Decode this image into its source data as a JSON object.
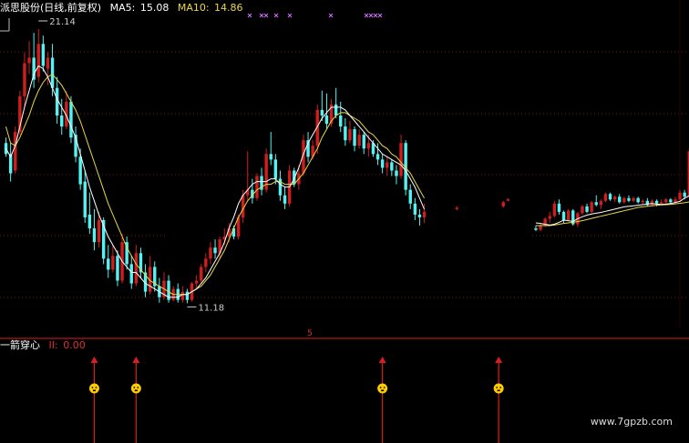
{
  "header": {
    "name": "派思股份(日线,前复权)",
    "ma5_label": "MA5:",
    "ma5_value": "15.08",
    "ma10_label": "MA10:",
    "ma10_value": "14.86"
  },
  "indicator": {
    "name": "一箭穿心",
    "value_label": "II:",
    "value": "0.00",
    "marker_label": "5"
  },
  "watermark": "www.7gpzb.com",
  "colors": {
    "up": "#d01e1e",
    "down": "#54f2f2",
    "ma5": "#ffffff",
    "ma10": "#e8d84a",
    "grid": "#7a1010",
    "axis": "#b01818",
    "signal": "#d81e1e",
    "face": "#ffcc00",
    "ticks": "#d070ff"
  },
  "chart_data": {
    "type": "candlestick",
    "y_range": [
      10.3,
      21.6
    ],
    "annotations": [
      {
        "label": "21.14",
        "candle": 7,
        "value": 21.14
      },
      {
        "label": "11.18",
        "candle": 39,
        "value": 11.18
      }
    ],
    "ma5": [
      16.8,
      16.5,
      16.9,
      17.6,
      18.3,
      18.9,
      19.5,
      19.8,
      19.7,
      19.4,
      19.0,
      18.6,
      18.3,
      18.0,
      17.6,
      17.2,
      16.6,
      16.0,
      15.4,
      14.9,
      14.4,
      14.0,
      13.6,
      13.3,
      13.0,
      12.7,
      12.5,
      12.3,
      12.3,
      12.1,
      11.9,
      11.8,
      11.7,
      11.6,
      11.5,
      11.4,
      11.4,
      11.4,
      11.5,
      11.5,
      11.6,
      11.7,
      11.9,
      12.1,
      12.4,
      12.7,
      13.0,
      13.4,
      13.9,
      14.3,
      14.8,
      15.1,
      15.3,
      15.5,
      15.6,
      15.6,
      15.6,
      15.7,
      15.7,
      15.5,
      15.4,
      15.4,
      15.7,
      16.1,
      16.6,
      17.0,
      17.3,
      17.6,
      17.9,
      18.1,
      18.3,
      18.3,
      18.3,
      18.2,
      18.0,
      17.8,
      17.6,
      17.4,
      17.2,
      17.0,
      16.8,
      16.6,
      16.5,
      16.4,
      16.3,
      16.2,
      16.0,
      15.7,
      15.4,
      15.0,
      14.6
    ],
    "ma10": [
      17.6,
      17.0,
      16.9,
      17.2,
      17.6,
      18.0,
      18.5,
      18.9,
      19.2,
      19.4,
      19.5,
      19.3,
      19.1,
      18.8,
      18.5,
      18.2,
      17.8,
      17.3,
      16.8,
      16.3,
      15.8,
      15.3,
      14.8,
      14.4,
      14.0,
      13.6,
      13.2,
      12.9,
      12.6,
      12.4,
      12.2,
      12.0,
      11.9,
      11.8,
      11.7,
      11.6,
      11.5,
      11.5,
      11.5,
      11.5,
      11.6,
      11.7,
      11.8,
      12.0,
      12.2,
      12.5,
      12.8,
      13.1,
      13.5,
      13.9,
      14.3,
      14.6,
      14.9,
      15.1,
      15.3,
      15.4,
      15.5,
      15.5,
      15.6,
      15.6,
      15.5,
      15.5,
      15.5,
      15.7,
      15.9,
      16.2,
      16.5,
      16.8,
      17.2,
      17.5,
      17.8,
      18.0,
      18.1,
      18.1,
      18.0,
      17.9,
      17.8,
      17.6,
      17.4,
      17.3,
      17.1,
      16.9,
      16.8,
      16.6,
      16.5,
      16.3,
      16.1,
      15.9,
      15.6,
      15.3,
      15.0
    ],
    "ma_late": {
      "start": 114,
      "ma5": [
        14.1,
        14.08,
        14.05,
        14.02,
        14.05,
        14.12,
        14.2,
        14.18,
        14.15,
        14.25,
        14.32,
        14.38,
        14.42,
        14.45,
        14.48,
        14.52,
        14.56,
        14.6,
        14.64,
        14.68,
        14.7,
        14.72,
        14.74,
        14.76,
        14.78,
        14.8,
        14.78,
        14.77,
        14.78,
        14.8,
        14.84,
        14.88,
        15.0,
        15.08
      ],
      "ma10": [
        14.0,
        14.0,
        14.0,
        14.0,
        14.02,
        14.05,
        14.08,
        14.1,
        14.12,
        14.15,
        14.18,
        14.22,
        14.26,
        14.3,
        14.34,
        14.38,
        14.42,
        14.46,
        14.5,
        14.54,
        14.58,
        14.62,
        14.66,
        14.68,
        14.7,
        14.72,
        14.74,
        14.75,
        14.76,
        14.77,
        14.79,
        14.81,
        14.83,
        14.86
      ]
    },
    "ohlc": [
      [
        17.0,
        17.2,
        16.5,
        16.6
      ],
      [
        16.6,
        17.0,
        15.6,
        15.9
      ],
      [
        16.0,
        17.6,
        15.9,
        17.4
      ],
      [
        17.4,
        18.9,
        17.3,
        18.7
      ],
      [
        18.7,
        20.3,
        18.3,
        19.9
      ],
      [
        19.9,
        20.7,
        19.5,
        20.1
      ],
      [
        20.1,
        21.0,
        19.0,
        19.3
      ],
      [
        19.4,
        21.14,
        19.2,
        20.6
      ],
      [
        20.6,
        20.9,
        19.6,
        19.8
      ],
      [
        19.7,
        20.3,
        19.1,
        20.1
      ],
      [
        20.1,
        20.6,
        18.7,
        19.0
      ],
      [
        19.0,
        19.4,
        17.7,
        18.0
      ],
      [
        18.0,
        18.6,
        17.3,
        17.6
      ],
      [
        17.6,
        18.9,
        17.5,
        18.5
      ],
      [
        18.5,
        18.7,
        17.0,
        17.2
      ],
      [
        17.3,
        17.6,
        16.3,
        16.5
      ],
      [
        16.5,
        16.8,
        15.3,
        15.5
      ],
      [
        15.6,
        16.0,
        14.1,
        14.3
      ],
      [
        14.4,
        15.2,
        13.7,
        13.9
      ],
      [
        13.9,
        14.6,
        13.1,
        13.4
      ],
      [
        13.4,
        14.5,
        13.2,
        14.2
      ],
      [
        14.2,
        14.3,
        12.6,
        12.8
      ],
      [
        12.8,
        13.3,
        12.1,
        12.4
      ],
      [
        12.4,
        13.3,
        12.3,
        12.9
      ],
      [
        12.9,
        13.1,
        11.8,
        12.0
      ],
      [
        12.0,
        13.7,
        11.9,
        13.4
      ],
      [
        13.4,
        13.6,
        12.4,
        12.6
      ],
      [
        12.6,
        12.9,
        11.7,
        11.9
      ],
      [
        11.9,
        13.3,
        11.8,
        13.0
      ],
      [
        13.0,
        13.2,
        12.1,
        12.3
      ],
      [
        12.3,
        12.6,
        11.4,
        11.6
      ],
      [
        11.6,
        12.9,
        11.5,
        12.5
      ],
      [
        12.5,
        12.7,
        11.6,
        11.8
      ],
      [
        11.8,
        12.1,
        11.2,
        11.4
      ],
      [
        11.4,
        12.3,
        11.3,
        12.0
      ],
      [
        12.0,
        12.2,
        11.2,
        11.3
      ],
      [
        11.3,
        11.8,
        11.25,
        11.7
      ],
      [
        11.7,
        11.9,
        11.2,
        11.3
      ],
      [
        11.3,
        11.8,
        11.2,
        11.6
      ],
      [
        11.6,
        11.7,
        11.18,
        11.3
      ],
      [
        11.3,
        11.95,
        11.25,
        11.9
      ],
      [
        11.9,
        12.2,
        11.7,
        12.0
      ],
      [
        12.0,
        12.6,
        11.9,
        12.5
      ],
      [
        12.5,
        13.0,
        12.3,
        12.8
      ],
      [
        12.8,
        13.4,
        12.6,
        13.2
      ],
      [
        13.2,
        13.5,
        12.8,
        13.0
      ],
      [
        13.0,
        13.6,
        12.8,
        13.5
      ],
      [
        13.5,
        13.9,
        13.3,
        13.6
      ],
      [
        13.6,
        14.1,
        13.4,
        13.9
      ],
      [
        13.9,
        14.0,
        13.5,
        13.6
      ],
      [
        13.6,
        14.4,
        13.5,
        14.3
      ],
      [
        14.3,
        15.3,
        14.1,
        15.1
      ],
      [
        15.1,
        16.7,
        14.9,
        15.3
      ],
      [
        15.3,
        15.7,
        14.8,
        15.0
      ],
      [
        15.0,
        15.9,
        14.9,
        15.8
      ],
      [
        15.8,
        16.1,
        15.1,
        15.3
      ],
      [
        15.3,
        16.8,
        15.2,
        16.6
      ],
      [
        16.6,
        17.4,
        16.2,
        16.4
      ],
      [
        16.4,
        16.6,
        15.5,
        15.7
      ],
      [
        15.7,
        16.0,
        14.9,
        15.1
      ],
      [
        15.1,
        15.4,
        14.6,
        14.8
      ],
      [
        14.8,
        16.2,
        14.7,
        16.0
      ],
      [
        16.0,
        16.1,
        15.4,
        15.5
      ],
      [
        15.5,
        16.2,
        15.3,
        15.9
      ],
      [
        15.9,
        17.3,
        15.8,
        17.1
      ],
      [
        17.1,
        17.4,
        16.3,
        16.5
      ],
      [
        16.5,
        17.1,
        16.4,
        16.9
      ],
      [
        16.9,
        18.4,
        16.6,
        18.2
      ],
      [
        18.2,
        18.9,
        17.8,
        18.0
      ],
      [
        18.0,
        18.8,
        17.5,
        17.7
      ],
      [
        17.7,
        18.6,
        17.6,
        18.4
      ],
      [
        18.4,
        19.0,
        17.9,
        18.0
      ],
      [
        18.0,
        18.5,
        17.4,
        17.6
      ],
      [
        17.6,
        17.9,
        16.9,
        17.1
      ],
      [
        17.1,
        17.8,
        17.0,
        17.5
      ],
      [
        17.5,
        17.6,
        16.7,
        16.9
      ],
      [
        16.9,
        17.5,
        16.8,
        17.3
      ],
      [
        17.3,
        17.4,
        16.6,
        16.8
      ],
      [
        16.8,
        17.3,
        16.5,
        17.0
      ],
      [
        17.0,
        17.1,
        16.5,
        16.6
      ],
      [
        16.6,
        17.0,
        16.2,
        16.4
      ],
      [
        16.4,
        16.6,
        15.9,
        16.1
      ],
      [
        16.1,
        16.5,
        15.8,
        16.3
      ],
      [
        16.3,
        16.4,
        15.8,
        16.0
      ],
      [
        16.0,
        16.2,
        15.5,
        15.8
      ],
      [
        15.8,
        17.3,
        15.7,
        17.0
      ],
      [
        17.0,
        17.1,
        15.1,
        15.3
      ],
      [
        15.3,
        15.5,
        14.6,
        14.8
      ],
      [
        14.8,
        15.0,
        14.2,
        14.4
      ],
      [
        14.4,
        14.6,
        14.0,
        14.3
      ],
      [
        14.3,
        14.8,
        14.1,
        14.5
      ]
    ],
    "ohlc_mid": [
      {
        "index": 97,
        "bar": [
          14.6,
          14.7,
          14.55,
          14.65
        ]
      },
      {
        "index": 107,
        "bar": [
          14.7,
          14.9,
          14.65,
          14.85
        ]
      },
      {
        "index": 108,
        "bar": [
          14.9,
          15.0,
          14.9,
          14.95
        ]
      }
    ],
    "ohlc_late": {
      "start": 114,
      "bars": [
        [
          13.9,
          14.0,
          13.8,
          13.85
        ],
        [
          13.85,
          14.05,
          13.8,
          14.0
        ],
        [
          14.0,
          14.3,
          13.95,
          14.25
        ],
        [
          14.25,
          14.5,
          14.1,
          14.35
        ],
        [
          14.35,
          14.9,
          14.3,
          14.8
        ],
        [
          14.8,
          14.95,
          14.4,
          14.5
        ],
        [
          14.5,
          14.55,
          14.1,
          14.2
        ],
        [
          14.2,
          14.6,
          14.15,
          14.55
        ],
        [
          14.55,
          14.6,
          14.0,
          14.05
        ],
        [
          14.05,
          14.5,
          13.95,
          14.45
        ],
        [
          14.45,
          14.75,
          14.4,
          14.7
        ],
        [
          14.7,
          14.8,
          14.45,
          14.5
        ],
        [
          14.5,
          14.9,
          14.45,
          14.85
        ],
        [
          14.85,
          15.1,
          14.7,
          14.75
        ],
        [
          14.75,
          14.95,
          14.6,
          14.9
        ],
        [
          14.9,
          15.2,
          14.85,
          15.15
        ],
        [
          15.15,
          15.2,
          14.9,
          14.95
        ],
        [
          14.95,
          15.1,
          14.85,
          15.05
        ],
        [
          15.05,
          15.15,
          14.8,
          14.85
        ],
        [
          14.85,
          15.05,
          14.8,
          15.0
        ],
        [
          15.0,
          15.1,
          14.85,
          14.9
        ],
        [
          14.9,
          15.05,
          14.85,
          15.0
        ],
        [
          15.0,
          15.05,
          14.8,
          14.85
        ],
        [
          14.85,
          14.95,
          14.75,
          14.9
        ],
        [
          14.9,
          15.0,
          14.7,
          14.75
        ],
        [
          14.75,
          14.95,
          14.7,
          14.9
        ],
        [
          14.9,
          14.95,
          14.7,
          14.8
        ],
        [
          14.8,
          14.95,
          14.75,
          14.85
        ],
        [
          14.85,
          15.0,
          14.75,
          14.95
        ],
        [
          14.95,
          15.0,
          14.8,
          14.85
        ],
        [
          14.85,
          15.05,
          14.8,
          14.95
        ],
        [
          14.95,
          15.3,
          14.9,
          15.2
        ],
        [
          15.2,
          15.3,
          14.95,
          15.05
        ],
        [
          15.05,
          16.8,
          15.0,
          16.7
        ]
      ]
    },
    "signals": [
      19,
      28,
      81,
      106
    ]
  }
}
